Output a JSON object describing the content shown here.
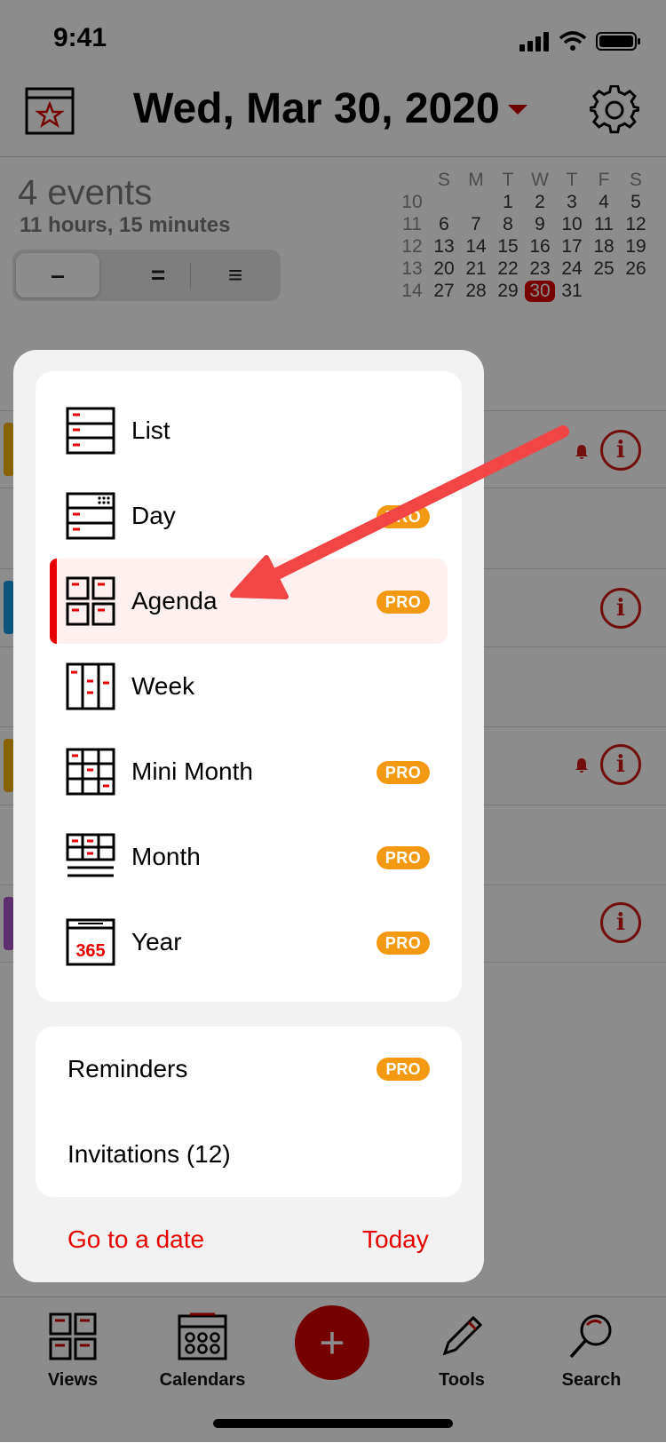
{
  "status_bar": {
    "time": "9:41"
  },
  "header": {
    "title": "Wed, Mar 30, 2020"
  },
  "summary": {
    "events_count": "4 events",
    "duration": "11 hours, 15 minutes",
    "segments": [
      "–",
      "=",
      "≡"
    ]
  },
  "mini_month": {
    "weekday_headers": [
      "S",
      "M",
      "T",
      "W",
      "T",
      "F",
      "S"
    ],
    "weeks": [
      {
        "wk": "10",
        "days": [
          "",
          "",
          "1",
          "2",
          "3",
          "4",
          "5"
        ]
      },
      {
        "wk": "11",
        "days": [
          "6",
          "7",
          "8",
          "9",
          "10",
          "11",
          "12"
        ]
      },
      {
        "wk": "12",
        "days": [
          "13",
          "14",
          "15",
          "16",
          "17",
          "18",
          "19"
        ]
      },
      {
        "wk": "13",
        "days": [
          "20",
          "21",
          "22",
          "23",
          "24",
          "25",
          "26"
        ]
      },
      {
        "wk": "14",
        "days": [
          "27",
          "28",
          "29",
          "30",
          "31",
          "",
          ""
        ]
      }
    ],
    "today": "30"
  },
  "views_menu": {
    "items": [
      {
        "label": "List",
        "pro": false,
        "icon": "list-view-icon"
      },
      {
        "label": "Day",
        "pro": true,
        "icon": "day-view-icon"
      },
      {
        "label": "Agenda",
        "pro": true,
        "icon": "agenda-view-icon",
        "active": true
      },
      {
        "label": "Week",
        "pro": false,
        "icon": "week-view-icon"
      },
      {
        "label": "Mini Month",
        "pro": true,
        "icon": "mini-month-view-icon"
      },
      {
        "label": "Month",
        "pro": true,
        "icon": "month-view-icon"
      },
      {
        "label": "Year",
        "pro": true,
        "icon": "year-view-icon"
      }
    ],
    "pro_label": "PRO",
    "year_icon_text": "365",
    "reminders": "Reminders",
    "invitations": "Invitations (12)",
    "go_to_date": "Go to a date",
    "today": "Today"
  },
  "tab_bar": {
    "views": "Views",
    "calendars": "Calendars",
    "tools": "Tools",
    "search": "Search"
  },
  "colors": {
    "accent": "#e60000",
    "pro_badge": "#f39a12",
    "active_row_bg": "#fff0f0"
  }
}
